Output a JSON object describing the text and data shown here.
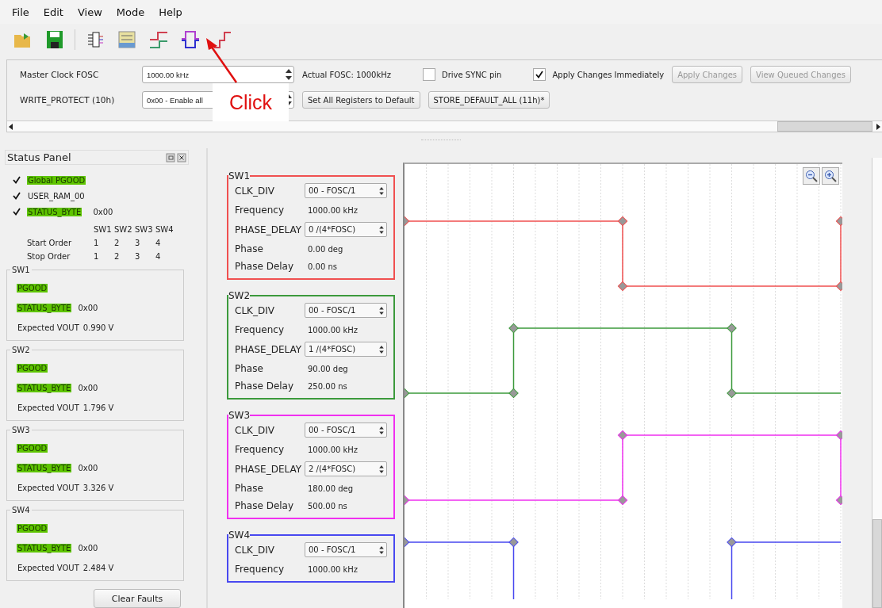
{
  "menu": [
    "File",
    "Edit",
    "View",
    "Mode",
    "Help"
  ],
  "toolbar": [
    {
      "kind": "open"
    },
    {
      "kind": "save"
    },
    {
      "kind": "chip"
    },
    {
      "kind": "registers"
    },
    {
      "kind": "step"
    },
    {
      "kind": "pulse"
    },
    {
      "kind": "stair"
    }
  ],
  "settings": {
    "rows": [
      [
        {
          "kind": "label",
          "text": "Master Clock FOSC"
        },
        {
          "kind": "spin",
          "value": "1000.00 kHz"
        },
        {
          "kind": "text",
          "text": "Actual FOSC: 1000kHz"
        },
        {
          "kind": "check",
          "label": "Drive SYNC pin",
          "checked": false
        },
        {
          "kind": "check",
          "label": "Apply Changes Immediately",
          "checked": true
        },
        {
          "kind": "button",
          "label": "Apply Changes",
          "disabled": true
        },
        {
          "kind": "button",
          "label": "View Queued Changes",
          "disabled": true
        }
      ],
      [
        {
          "kind": "label",
          "text": "WRITE_PROTECT (10h)"
        },
        {
          "kind": "spin",
          "value": "0x00 - Enable all"
        },
        {
          "kind": "button",
          "label": "Set All Registers to Default",
          "disabled": false
        },
        {
          "kind": "button",
          "label": "STORE_DEFAULT_ALL (11h)*",
          "disabled": false
        }
      ]
    ]
  },
  "annotation": {
    "text": "Click"
  },
  "status_panel": {
    "title": "Status Panel",
    "flags": [
      {
        "label": "Global PGOOD",
        "checked": true,
        "ok": true
      },
      {
        "label": "USER_RAM_00",
        "checked": true,
        "ok": false
      },
      {
        "label": "STATUS_BYTE",
        "checked": true,
        "ok": true,
        "value": "0x00"
      }
    ],
    "order": {
      "columns": [
        "SW1",
        "SW2",
        "SW3",
        "SW4"
      ],
      "rows": [
        {
          "label": "Start Order",
          "values": [
            "1",
            "2",
            "3",
            "4"
          ]
        },
        {
          "label": "Stop Order",
          "values": [
            "1",
            "2",
            "3",
            "4"
          ]
        }
      ]
    },
    "groups": [
      {
        "title": "SW1",
        "pgood": {
          "label": "PGOOD",
          "ok": true
        },
        "status": {
          "label": "STATUS_BYTE",
          "ok": true,
          "value": "0x00"
        },
        "vout": {
          "label": "Expected VOUT",
          "value": "0.990 V"
        }
      },
      {
        "title": "SW2",
        "pgood": {
          "label": "PGOOD",
          "ok": true
        },
        "status": {
          "label": "STATUS_BYTE",
          "ok": true,
          "value": "0x00"
        },
        "vout": {
          "label": "Expected VOUT",
          "value": "1.796 V"
        }
      },
      {
        "title": "SW3",
        "pgood": {
          "label": "PGOOD",
          "ok": true
        },
        "status": {
          "label": "STATUS_BYTE",
          "ok": true,
          "value": "0x00"
        },
        "vout": {
          "label": "Expected VOUT",
          "value": "3.326 V"
        }
      },
      {
        "title": "SW4",
        "pgood": {
          "label": "PGOOD",
          "ok": true
        },
        "status": {
          "label": "STATUS_BYTE",
          "ok": true,
          "value": "0x00"
        },
        "vout": {
          "label": "Expected VOUT",
          "value": "2.484 V"
        }
      }
    ],
    "clear_button": "Clear Faults"
  },
  "channels": [
    {
      "name": "SW1",
      "color": "#f05050",
      "rows": [
        {
          "kind": "combo",
          "label": "CLK_DIV",
          "value": "00 - FOSC/1"
        },
        {
          "kind": "text",
          "label": "Frequency",
          "value": "1000.00 kHz"
        },
        {
          "kind": "combo",
          "label": "PHASE_DELAY",
          "value": "0 /(4*FOSC)"
        },
        {
          "kind": "text",
          "label": "Phase",
          "value": "0.00 deg"
        },
        {
          "kind": "text",
          "label": "Phase Delay",
          "value": "0.00 ns"
        }
      ]
    },
    {
      "name": "SW2",
      "color": "#3c9a3c",
      "rows": [
        {
          "kind": "combo",
          "label": "CLK_DIV",
          "value": "00 - FOSC/1"
        },
        {
          "kind": "text",
          "label": "Frequency",
          "value": "1000.00 kHz"
        },
        {
          "kind": "combo",
          "label": "PHASE_DELAY",
          "value": "1 /(4*FOSC)"
        },
        {
          "kind": "text",
          "label": "Phase",
          "value": "90.00 deg"
        },
        {
          "kind": "text",
          "label": "Phase Delay",
          "value": "250.00 ns"
        }
      ]
    },
    {
      "name": "SW3",
      "color": "#f030f0",
      "rows": [
        {
          "kind": "combo",
          "label": "CLK_DIV",
          "value": "00 - FOSC/1"
        },
        {
          "kind": "text",
          "label": "Frequency",
          "value": "1000.00 kHz"
        },
        {
          "kind": "combo",
          "label": "PHASE_DELAY",
          "value": "2 /(4*FOSC)"
        },
        {
          "kind": "text",
          "label": "Phase",
          "value": "180.00 deg"
        },
        {
          "kind": "text",
          "label": "Phase Delay",
          "value": "500.00 ns"
        }
      ]
    },
    {
      "name": "SW4",
      "color": "#4848f0",
      "rows": [
        {
          "kind": "combo",
          "label": "CLK_DIV",
          "value": "00 - FOSC/1"
        },
        {
          "kind": "text",
          "label": "Frequency",
          "value": "1000.00 kHz"
        }
      ]
    }
  ]
}
